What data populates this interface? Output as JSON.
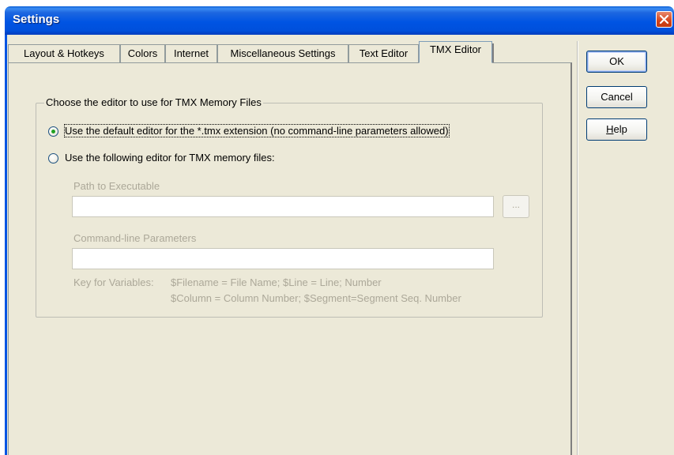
{
  "window": {
    "title": "Settings"
  },
  "tabs": [
    {
      "label": "Layout & Hotkeys"
    },
    {
      "label": "Colors"
    },
    {
      "label": "Internet"
    },
    {
      "label": "Miscellaneous Settings"
    },
    {
      "label": "Text Editor"
    },
    {
      "label": "TMX Editor",
      "active": true
    }
  ],
  "group": {
    "legend": "Choose the editor to use for TMX Memory Files",
    "option_default": "Use the default editor for the *.tmx extension (no command-line parameters allowed)",
    "option_custom": "Use the following editor for TMX memory files:",
    "selected": "option_default",
    "path_label": "Path to Executable",
    "path_value": "",
    "browse_label": "...",
    "params_label": "Command-line Parameters",
    "params_value": "",
    "key_label": "Key for Variables:",
    "key_line1": "$Filename = File Name; $Line = Line; Number",
    "key_line2": "$Column = Column Number; $Segment=Segment Seq. Number"
  },
  "buttons": {
    "ok": "OK",
    "cancel": "Cancel",
    "help_prefix": "",
    "help_mnemonic": "H",
    "help_rest": "elp"
  },
  "colors": {
    "titlebar": "#0054e3",
    "face": "#ece9d8",
    "close": "#d4431a",
    "radio_dot": "#21a121",
    "disabled_text": "#aca899"
  }
}
